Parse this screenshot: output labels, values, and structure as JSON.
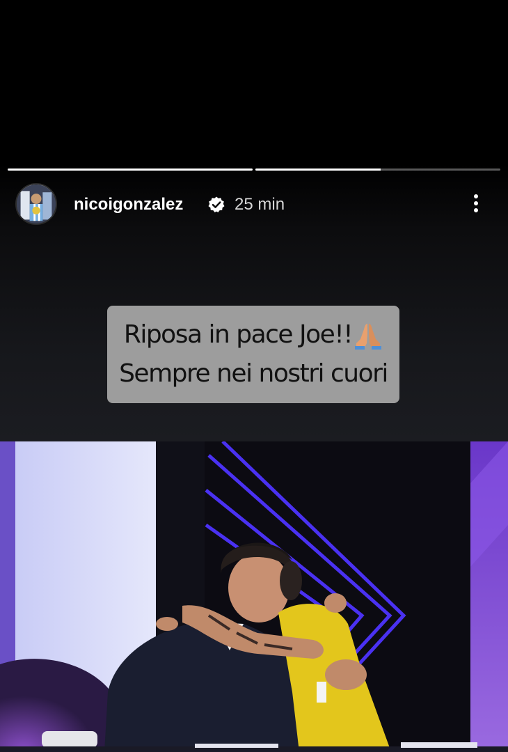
{
  "story": {
    "progress": [
      1.0,
      0.51
    ],
    "user": {
      "username": "nicoigonzalez",
      "verified": true,
      "time": "25 min"
    },
    "icons": {
      "verified": "verified-badge-icon",
      "more": "more-vertical-icon",
      "emoji": "folded-hands-emoji"
    },
    "caption": {
      "line1": "Riposa in pace Joe!!",
      "line2": "Sempre nei nostri cuori"
    },
    "colors": {
      "caption_bg": "#9d9d9d",
      "stage_accent": "#5a3cff",
      "jersey": "#e3c61c"
    }
  }
}
